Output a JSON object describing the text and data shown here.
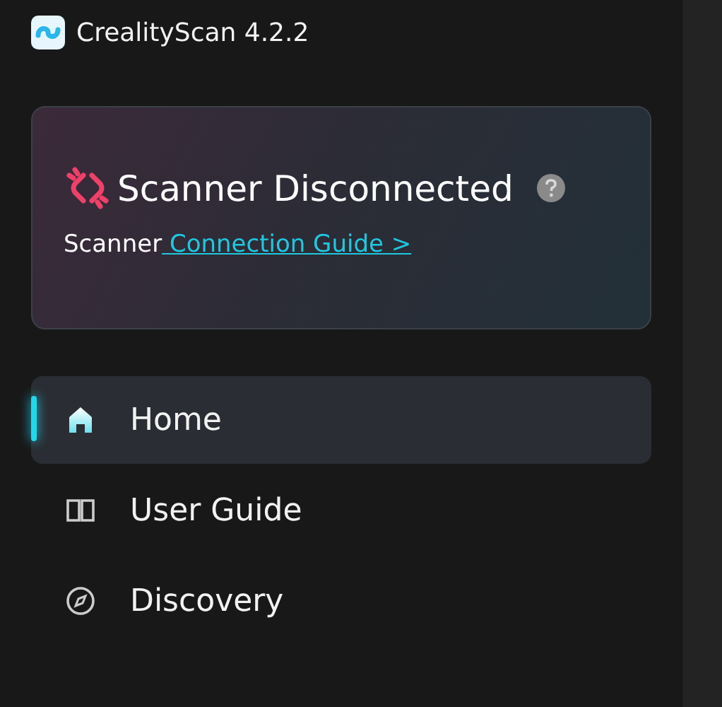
{
  "app": {
    "title": "CrealityScan 4.2.2"
  },
  "status_card": {
    "title": "Scanner Disconnected",
    "text": "Scanner",
    "link": " Connection Guide >"
  },
  "nav": [
    {
      "label": "Home",
      "selected": true
    },
    {
      "label": "User Guide",
      "selected": false
    },
    {
      "label": "Discovery",
      "selected": false
    }
  ]
}
